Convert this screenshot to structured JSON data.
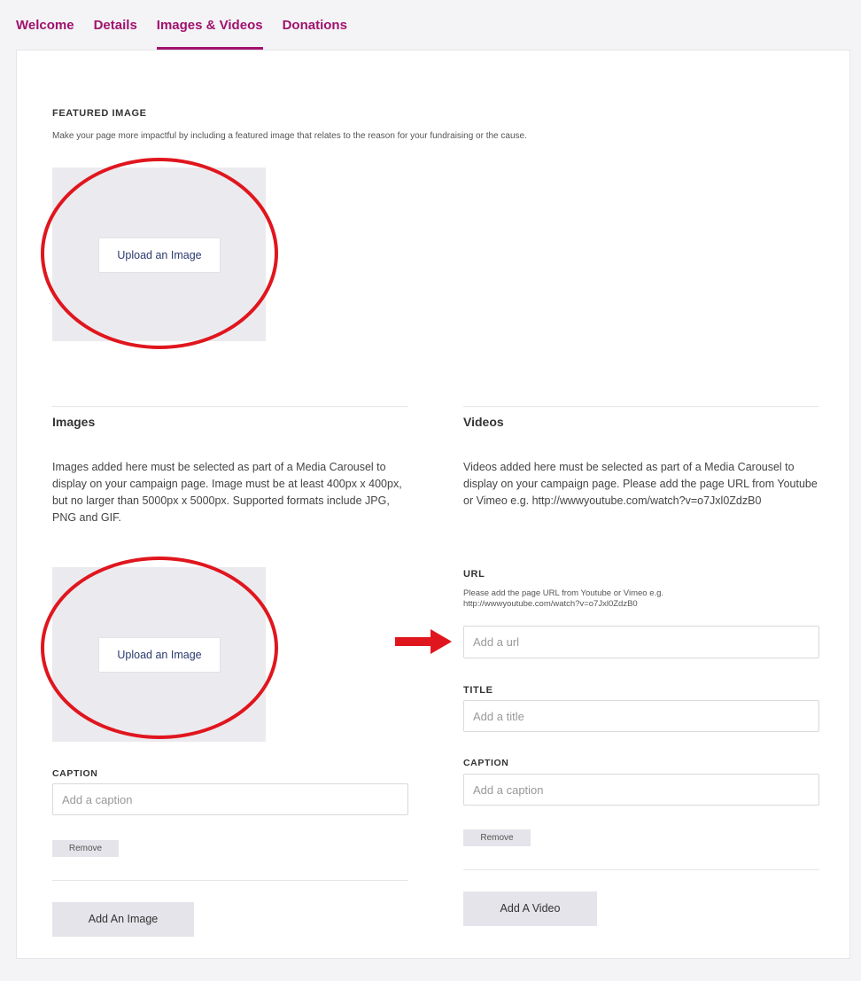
{
  "tabs": [
    {
      "label": "Welcome"
    },
    {
      "label": "Details"
    },
    {
      "label": "Images & Videos",
      "active": true
    },
    {
      "label": "Donations"
    }
  ],
  "featured": {
    "title": "FEATURED IMAGE",
    "description": "Make your page more impactful by including a featured image that relates to the reason for your fundraising or the cause.",
    "upload_label": "Upload an Image"
  },
  "images": {
    "heading": "Images",
    "description": "Images added here must be selected as part of a Media Carousel to display on your campaign page. Image must be at least 400px x 400px, but no larger than 5000px x 5000px. Supported formats include JPG, PNG and GIF.",
    "upload_label": "Upload an Image",
    "caption_label": "CAPTION",
    "caption_placeholder": "Add a caption",
    "remove_label": "Remove",
    "add_label": "Add An Image"
  },
  "videos": {
    "heading": "Videos",
    "description": "Videos added here must be selected as part of a Media Carousel to display on your campaign page. Please add the page URL from Youtube or Vimeo e.g. http://wwwyoutube.com/watch?v=o7Jxl0ZdzB0",
    "url_label": "URL",
    "url_help": "Please add the page URL from Youtube or Vimeo e.g. http://wwwyoutube.com/watch?v=o7Jxl0ZdzB0",
    "url_placeholder": "Add a url",
    "title_label": "TITLE",
    "title_placeholder": "Add a title",
    "caption_label": "CAPTION",
    "caption_placeholder": "Add a caption",
    "remove_label": "Remove",
    "add_label": "Add A Video"
  },
  "colors": {
    "accent": "#a0126e",
    "annotation": "#e0161e"
  }
}
